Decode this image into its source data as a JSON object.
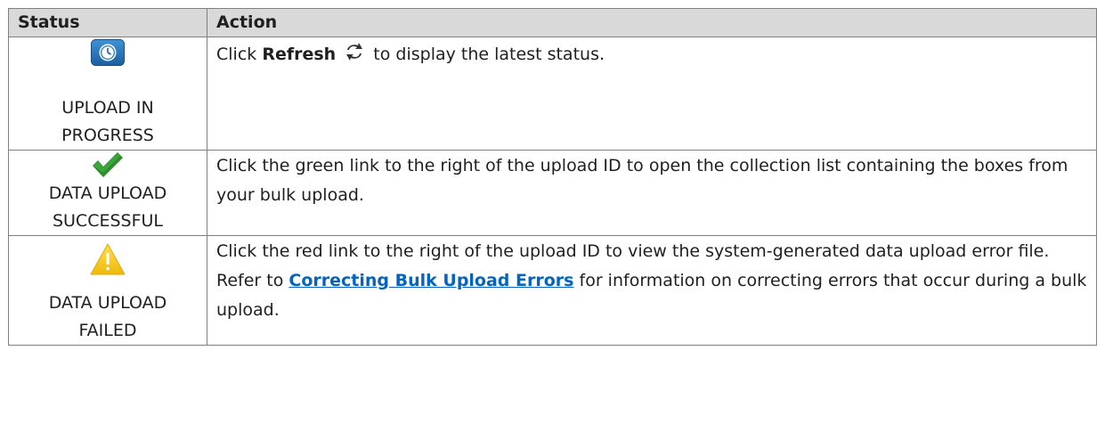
{
  "table": {
    "headers": [
      "Status",
      "Action"
    ],
    "rows": [
      {
        "status_icon": "clock-icon",
        "status_label_1": "UPLOAD IN",
        "status_label_2": "PROGRESS",
        "action_prefix": "Click",
        "action_bold": "Refresh",
        "action_icon": "refresh-icon",
        "action_suffix": "to display the latest status."
      },
      {
        "status_icon": "checkmark-icon",
        "status_label_1": "DATA UPLOAD",
        "status_label_2": "SUCCESSFUL",
        "action_text": "Click the green link to the right of the upload ID to open the collection list containing the boxes from your bulk upload."
      },
      {
        "status_icon": "warning-icon",
        "status_label_1": "DATA UPLOAD",
        "status_label_2": "FAILED",
        "action_prefix": "Click the red link to the right of the upload ID to view the system-generated data upload error file. Refer to",
        "action_link": "Correcting Bulk Upload Errors",
        "action_suffix": "for information on correcting errors that occur during a bulk upload."
      }
    ]
  },
  "colors": {
    "header_bg": "#d9d9d9",
    "border": "#7f7f7f",
    "link": "#0563c1",
    "check_green": "#2e8b2e",
    "warning_yellow": "#f2c81d",
    "clock_blue": "#2a7cc7"
  }
}
